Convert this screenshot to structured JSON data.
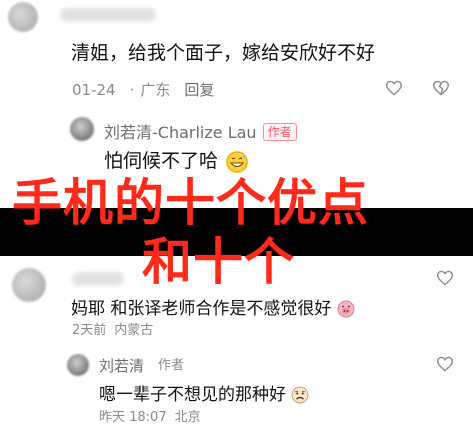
{
  "comments": [
    {
      "text": "清姐，给我个面子，嫁给安欣好不好",
      "date": "01-24",
      "location": "广东",
      "reply": "回复"
    }
  ],
  "author_reply_1": {
    "name": "刘若清-Charlize Lau",
    "badge": "作者",
    "text": "怕伺候不了哈"
  },
  "overlay": {
    "line1": "手机的十个优点",
    "line2": "和十个"
  },
  "comment_2": {
    "text": "妈耶 和张译老师合作是不感觉很好",
    "date": "2天前",
    "location": "内蒙古"
  },
  "author_reply_2": {
    "name": "刘若清",
    "badge": "作者",
    "text": "嗯一辈子不想见的那种好",
    "date": "昨天 18:07",
    "location": "北京"
  },
  "icons": {
    "like": "heart-outline-icon",
    "dislike": "broken-heart-icon"
  },
  "colors": {
    "overlay_text": "#ff2a1a",
    "banner_bg": "#000000",
    "badge": "#ff4d5e"
  }
}
